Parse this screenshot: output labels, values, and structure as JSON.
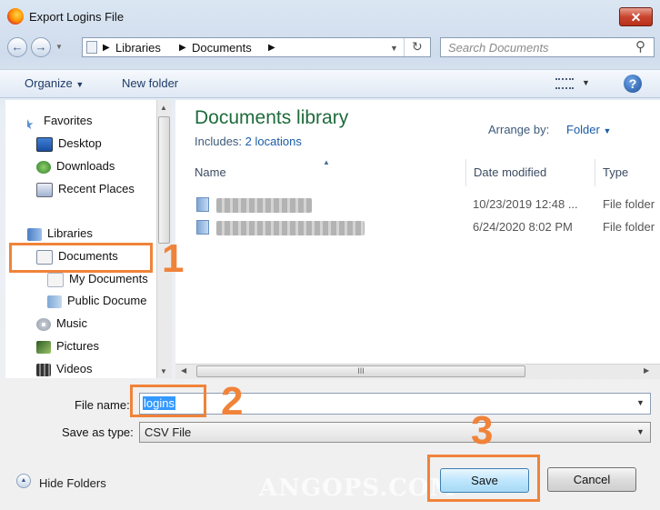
{
  "window": {
    "title": "Export Logins File"
  },
  "breadcrumb": [
    "Libraries",
    "Documents"
  ],
  "search": {
    "placeholder": "Search Documents"
  },
  "toolbar": {
    "organize": "Organize",
    "new_folder": "New folder"
  },
  "sidebar": {
    "items": [
      {
        "label": "Favorites",
        "icon": "star-icon"
      },
      {
        "label": "Desktop",
        "icon": "desktop-icon"
      },
      {
        "label": "Downloads",
        "icon": "downloads-icon"
      },
      {
        "label": "Recent Places",
        "icon": "recent-places-icon"
      },
      {
        "label": "Libraries",
        "icon": "libraries-icon"
      },
      {
        "label": "Documents",
        "icon": "documents-icon"
      },
      {
        "label": "My Documents",
        "icon": "document-icon"
      },
      {
        "label": "Public Docume",
        "icon": "document-icon"
      },
      {
        "label": "Music",
        "icon": "music-icon"
      },
      {
        "label": "Pictures",
        "icon": "pictures-icon"
      },
      {
        "label": "Videos",
        "icon": "videos-icon"
      }
    ]
  },
  "library": {
    "title": "Documents library",
    "includes_label": "Includes:",
    "includes_link": "2 locations",
    "arrange_label": "Arrange by:",
    "arrange_value": "Folder"
  },
  "columns": {
    "name": "Name",
    "date": "Date modified",
    "type": "Type"
  },
  "files": [
    {
      "date": "10/23/2019 12:48 ...",
      "type": "File folder"
    },
    {
      "date": "6/24/2020 8:02 PM",
      "type": "File folder"
    }
  ],
  "hscroll_grip": "III",
  "form": {
    "filename_label": "File name:",
    "filename_value": "logins",
    "savetype_label": "Save as type:",
    "savetype_value": "CSV File"
  },
  "footer": {
    "hide_folders": "Hide Folders",
    "save": "Save",
    "cancel": "Cancel"
  },
  "steps": [
    "1",
    "2",
    "3"
  ],
  "watermark": "ANGOPS.COM",
  "colors": {
    "accent": "#f0833a",
    "library_title": "#1e6b3c",
    "link": "#1a5ca8",
    "selection": "#3399ff"
  }
}
